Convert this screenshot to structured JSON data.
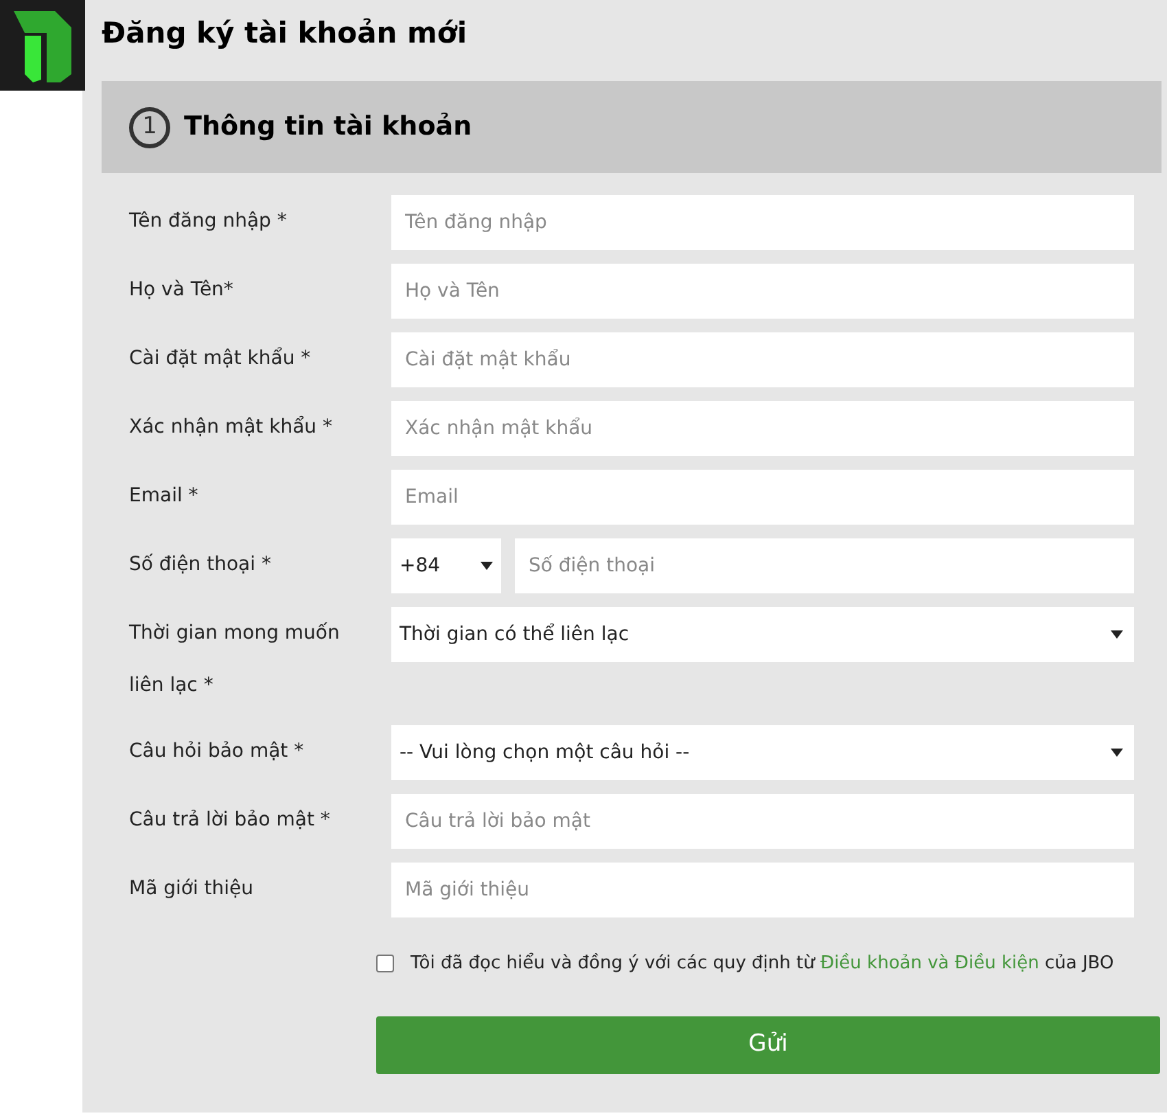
{
  "title": "Đăng ký tài khoản mới",
  "section": {
    "number": "1",
    "title": "Thông tin tài khoản"
  },
  "fields": [
    {
      "kind": "text",
      "label": "Tên đăng nhập *",
      "placeholder": "Tên đăng nhập"
    },
    {
      "kind": "text",
      "label": "Họ và Tên*",
      "placeholder": "Họ và Tên"
    },
    {
      "kind": "text",
      "label": "Cài đặt mật khẩu *",
      "placeholder": "Cài đặt mật khẩu"
    },
    {
      "kind": "text",
      "label": "Xác nhận mật khẩu *",
      "placeholder": "Xác nhận mật khẩu"
    },
    {
      "kind": "text",
      "label": "Email *",
      "placeholder": "Email"
    },
    {
      "kind": "phone",
      "label": "Số điện thoại *",
      "code": "+84",
      "placeholder": "Số điện thoại"
    },
    {
      "kind": "select",
      "label": "Thời gian mong muốn liên lạc *",
      "value": "Thời gian có thể liên lạc"
    },
    {
      "kind": "select",
      "label": "Câu hỏi bảo mật *",
      "value": "-- Vui lòng chọn một câu hỏi --"
    },
    {
      "kind": "text",
      "label": "Câu trả lời bảo mật *",
      "placeholder": "Câu trả lời bảo mật"
    },
    {
      "kind": "text",
      "label": "Mã giới thiệu",
      "placeholder": "Mã giới thiệu"
    }
  ],
  "agreement": {
    "checked": false,
    "before": "Tôi đã đọc hiểu và đồng ý với các quy định từ",
    "link": "Điều khoản và Điều kiện",
    "after": "của JBO"
  },
  "submit": "Gửi"
}
